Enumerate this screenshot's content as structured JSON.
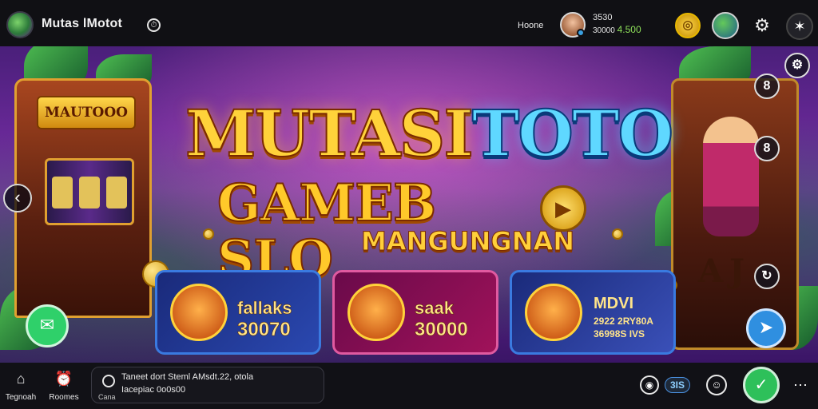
{
  "header": {
    "app_title": "Mutas lMotot",
    "title_badge_icon": "clock-icon",
    "home_link": "Hoone",
    "balance_top": "3530",
    "balance_bottom": "30000",
    "balance_win": "4.500",
    "settings_icon": "gear-icon",
    "star_icon": "star-icon"
  },
  "banner": {
    "title_gold": "MUTASI",
    "title_blue": "TOTO",
    "subtitle": "GAMEB SLO",
    "subtitle_small": "MANGUNGNAN",
    "slot_left_sign": "MAUTOOO",
    "slot_right_letters": "AJ",
    "side_icons": [
      "8",
      "8"
    ],
    "cards": [
      {
        "name": "fallaks",
        "value": "30070"
      },
      {
        "name": "saak",
        "value": "30000"
      },
      {
        "name": "MDVI",
        "line1": "2922 2RY80A",
        "line2": "36998S IVS"
      }
    ]
  },
  "bottom_nav": {
    "items": [
      {
        "label": "Tegnoah",
        "icon": "home-icon"
      },
      {
        "label": "Roomes",
        "icon": "alarm-icon"
      }
    ],
    "search_line1": "Taneet dort Steml AMsdt.22, otola",
    "search_line2": "Iacepiac 0o0s00",
    "search_caption": "Cana",
    "badge": "3IS",
    "colors": {
      "accent_green": "#2ec05a",
      "accent_blue": "#2f8fe0",
      "gold": "#ffd23a"
    }
  }
}
